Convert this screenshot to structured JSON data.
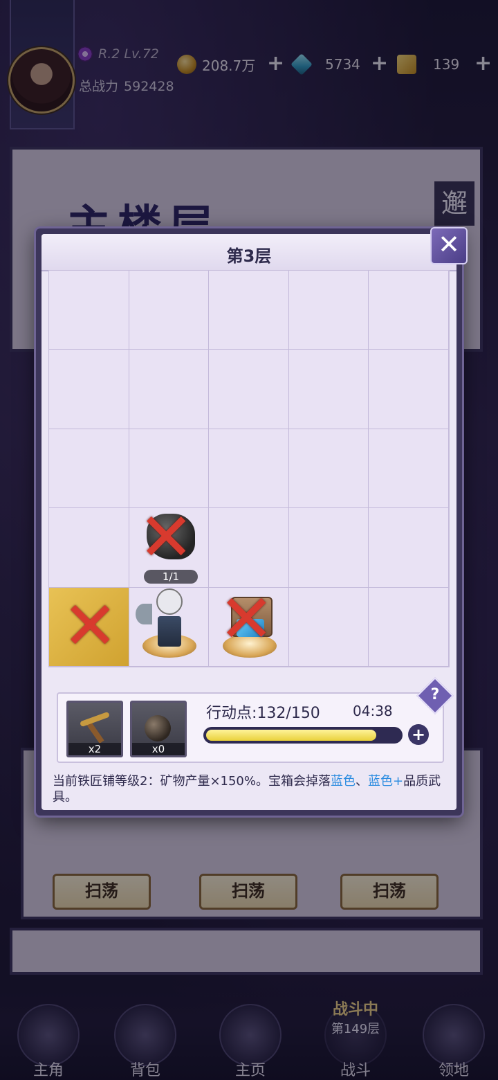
{
  "player": {
    "rank": "R.2 Lv.72",
    "power_label": "总战力",
    "power_value": "592428"
  },
  "resources": [
    {
      "name": "gold",
      "value": "208.7万",
      "icon": "gold-coin-icon"
    },
    {
      "name": "gem",
      "value": "5734",
      "icon": "blue-crystal-icon"
    },
    {
      "name": "ticket",
      "value": "139",
      "icon": "gold-ticket-icon"
    }
  ],
  "plus_symbol": "+",
  "background": {
    "panel_title": "主楼层",
    "side_tab": "邂",
    "sweep_buttons": [
      "扫荡",
      "扫荡",
      "扫荡"
    ]
  },
  "modal": {
    "title": "第3层",
    "close_symbol": "✕",
    "grid": {
      "rows": 5,
      "cols": 5,
      "ore_count": "1/1"
    },
    "items": [
      {
        "name": "pickaxe",
        "qty": "x2"
      },
      {
        "name": "bomb",
        "qty": "x0"
      }
    ],
    "action_points_label": "行动点:132/150",
    "action_points": {
      "current": 132,
      "max": 150
    },
    "timer": "04:38",
    "help_symbol": "?",
    "add_symbol": "+",
    "description": {
      "prefix": "当前铁匠铺等级2：矿物产量×150%。宝箱会掉落",
      "blue1": "蓝色",
      "sep": "、",
      "blue2": "蓝色+",
      "suffix": "品质武具。"
    }
  },
  "battle_status": {
    "status": "战斗中",
    "floor": "第149层"
  },
  "nav": [
    {
      "label": "主角",
      "icon": "hero-icon"
    },
    {
      "label": "背包",
      "icon": "bag-icon"
    },
    {
      "label": "主页",
      "icon": "home-book-icon"
    },
    {
      "label": "战斗",
      "icon": "battle-swords-icon"
    },
    {
      "label": "领地",
      "icon": "territory-castle-icon"
    }
  ]
}
